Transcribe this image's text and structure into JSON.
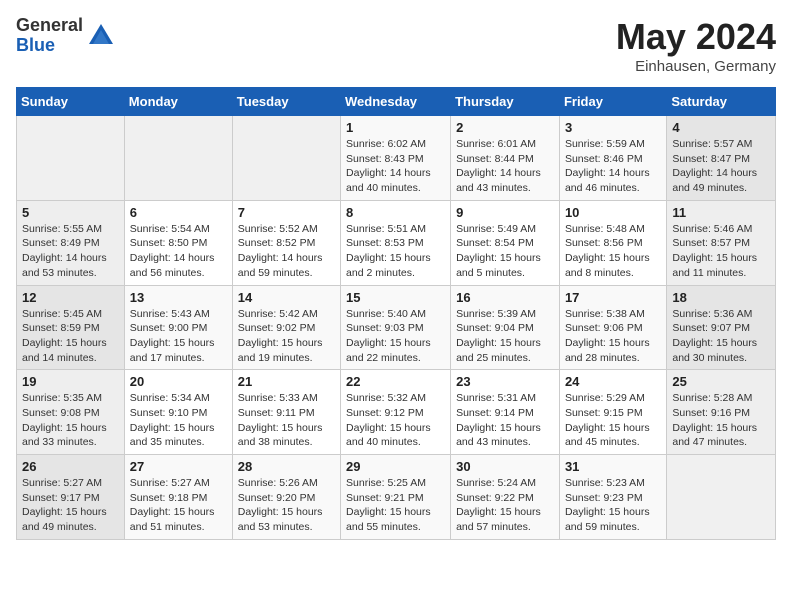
{
  "logo": {
    "general": "General",
    "blue": "Blue"
  },
  "title": "May 2024",
  "location": "Einhausen, Germany",
  "weekdays": [
    "Sunday",
    "Monday",
    "Tuesday",
    "Wednesday",
    "Thursday",
    "Friday",
    "Saturday"
  ],
  "weeks": [
    [
      {
        "day": "",
        "info": ""
      },
      {
        "day": "",
        "info": ""
      },
      {
        "day": "",
        "info": ""
      },
      {
        "day": "1",
        "info": "Sunrise: 6:02 AM\nSunset: 8:43 PM\nDaylight: 14 hours\nand 40 minutes."
      },
      {
        "day": "2",
        "info": "Sunrise: 6:01 AM\nSunset: 8:44 PM\nDaylight: 14 hours\nand 43 minutes."
      },
      {
        "day": "3",
        "info": "Sunrise: 5:59 AM\nSunset: 8:46 PM\nDaylight: 14 hours\nand 46 minutes."
      },
      {
        "day": "4",
        "info": "Sunrise: 5:57 AM\nSunset: 8:47 PM\nDaylight: 14 hours\nand 49 minutes."
      }
    ],
    [
      {
        "day": "5",
        "info": "Sunrise: 5:55 AM\nSunset: 8:49 PM\nDaylight: 14 hours\nand 53 minutes."
      },
      {
        "day": "6",
        "info": "Sunrise: 5:54 AM\nSunset: 8:50 PM\nDaylight: 14 hours\nand 56 minutes."
      },
      {
        "day": "7",
        "info": "Sunrise: 5:52 AM\nSunset: 8:52 PM\nDaylight: 14 hours\nand 59 minutes."
      },
      {
        "day": "8",
        "info": "Sunrise: 5:51 AM\nSunset: 8:53 PM\nDaylight: 15 hours\nand 2 minutes."
      },
      {
        "day": "9",
        "info": "Sunrise: 5:49 AM\nSunset: 8:54 PM\nDaylight: 15 hours\nand 5 minutes."
      },
      {
        "day": "10",
        "info": "Sunrise: 5:48 AM\nSunset: 8:56 PM\nDaylight: 15 hours\nand 8 minutes."
      },
      {
        "day": "11",
        "info": "Sunrise: 5:46 AM\nSunset: 8:57 PM\nDaylight: 15 hours\nand 11 minutes."
      }
    ],
    [
      {
        "day": "12",
        "info": "Sunrise: 5:45 AM\nSunset: 8:59 PM\nDaylight: 15 hours\nand 14 minutes."
      },
      {
        "day": "13",
        "info": "Sunrise: 5:43 AM\nSunset: 9:00 PM\nDaylight: 15 hours\nand 17 minutes."
      },
      {
        "day": "14",
        "info": "Sunrise: 5:42 AM\nSunset: 9:02 PM\nDaylight: 15 hours\nand 19 minutes."
      },
      {
        "day": "15",
        "info": "Sunrise: 5:40 AM\nSunset: 9:03 PM\nDaylight: 15 hours\nand 22 minutes."
      },
      {
        "day": "16",
        "info": "Sunrise: 5:39 AM\nSunset: 9:04 PM\nDaylight: 15 hours\nand 25 minutes."
      },
      {
        "day": "17",
        "info": "Sunrise: 5:38 AM\nSunset: 9:06 PM\nDaylight: 15 hours\nand 28 minutes."
      },
      {
        "day": "18",
        "info": "Sunrise: 5:36 AM\nSunset: 9:07 PM\nDaylight: 15 hours\nand 30 minutes."
      }
    ],
    [
      {
        "day": "19",
        "info": "Sunrise: 5:35 AM\nSunset: 9:08 PM\nDaylight: 15 hours\nand 33 minutes."
      },
      {
        "day": "20",
        "info": "Sunrise: 5:34 AM\nSunset: 9:10 PM\nDaylight: 15 hours\nand 35 minutes."
      },
      {
        "day": "21",
        "info": "Sunrise: 5:33 AM\nSunset: 9:11 PM\nDaylight: 15 hours\nand 38 minutes."
      },
      {
        "day": "22",
        "info": "Sunrise: 5:32 AM\nSunset: 9:12 PM\nDaylight: 15 hours\nand 40 minutes."
      },
      {
        "day": "23",
        "info": "Sunrise: 5:31 AM\nSunset: 9:14 PM\nDaylight: 15 hours\nand 43 minutes."
      },
      {
        "day": "24",
        "info": "Sunrise: 5:29 AM\nSunset: 9:15 PM\nDaylight: 15 hours\nand 45 minutes."
      },
      {
        "day": "25",
        "info": "Sunrise: 5:28 AM\nSunset: 9:16 PM\nDaylight: 15 hours\nand 47 minutes."
      }
    ],
    [
      {
        "day": "26",
        "info": "Sunrise: 5:27 AM\nSunset: 9:17 PM\nDaylight: 15 hours\nand 49 minutes."
      },
      {
        "day": "27",
        "info": "Sunrise: 5:27 AM\nSunset: 9:18 PM\nDaylight: 15 hours\nand 51 minutes."
      },
      {
        "day": "28",
        "info": "Sunrise: 5:26 AM\nSunset: 9:20 PM\nDaylight: 15 hours\nand 53 minutes."
      },
      {
        "day": "29",
        "info": "Sunrise: 5:25 AM\nSunset: 9:21 PM\nDaylight: 15 hours\nand 55 minutes."
      },
      {
        "day": "30",
        "info": "Sunrise: 5:24 AM\nSunset: 9:22 PM\nDaylight: 15 hours\nand 57 minutes."
      },
      {
        "day": "31",
        "info": "Sunrise: 5:23 AM\nSunset: 9:23 PM\nDaylight: 15 hours\nand 59 minutes."
      },
      {
        "day": "",
        "info": ""
      }
    ]
  ]
}
